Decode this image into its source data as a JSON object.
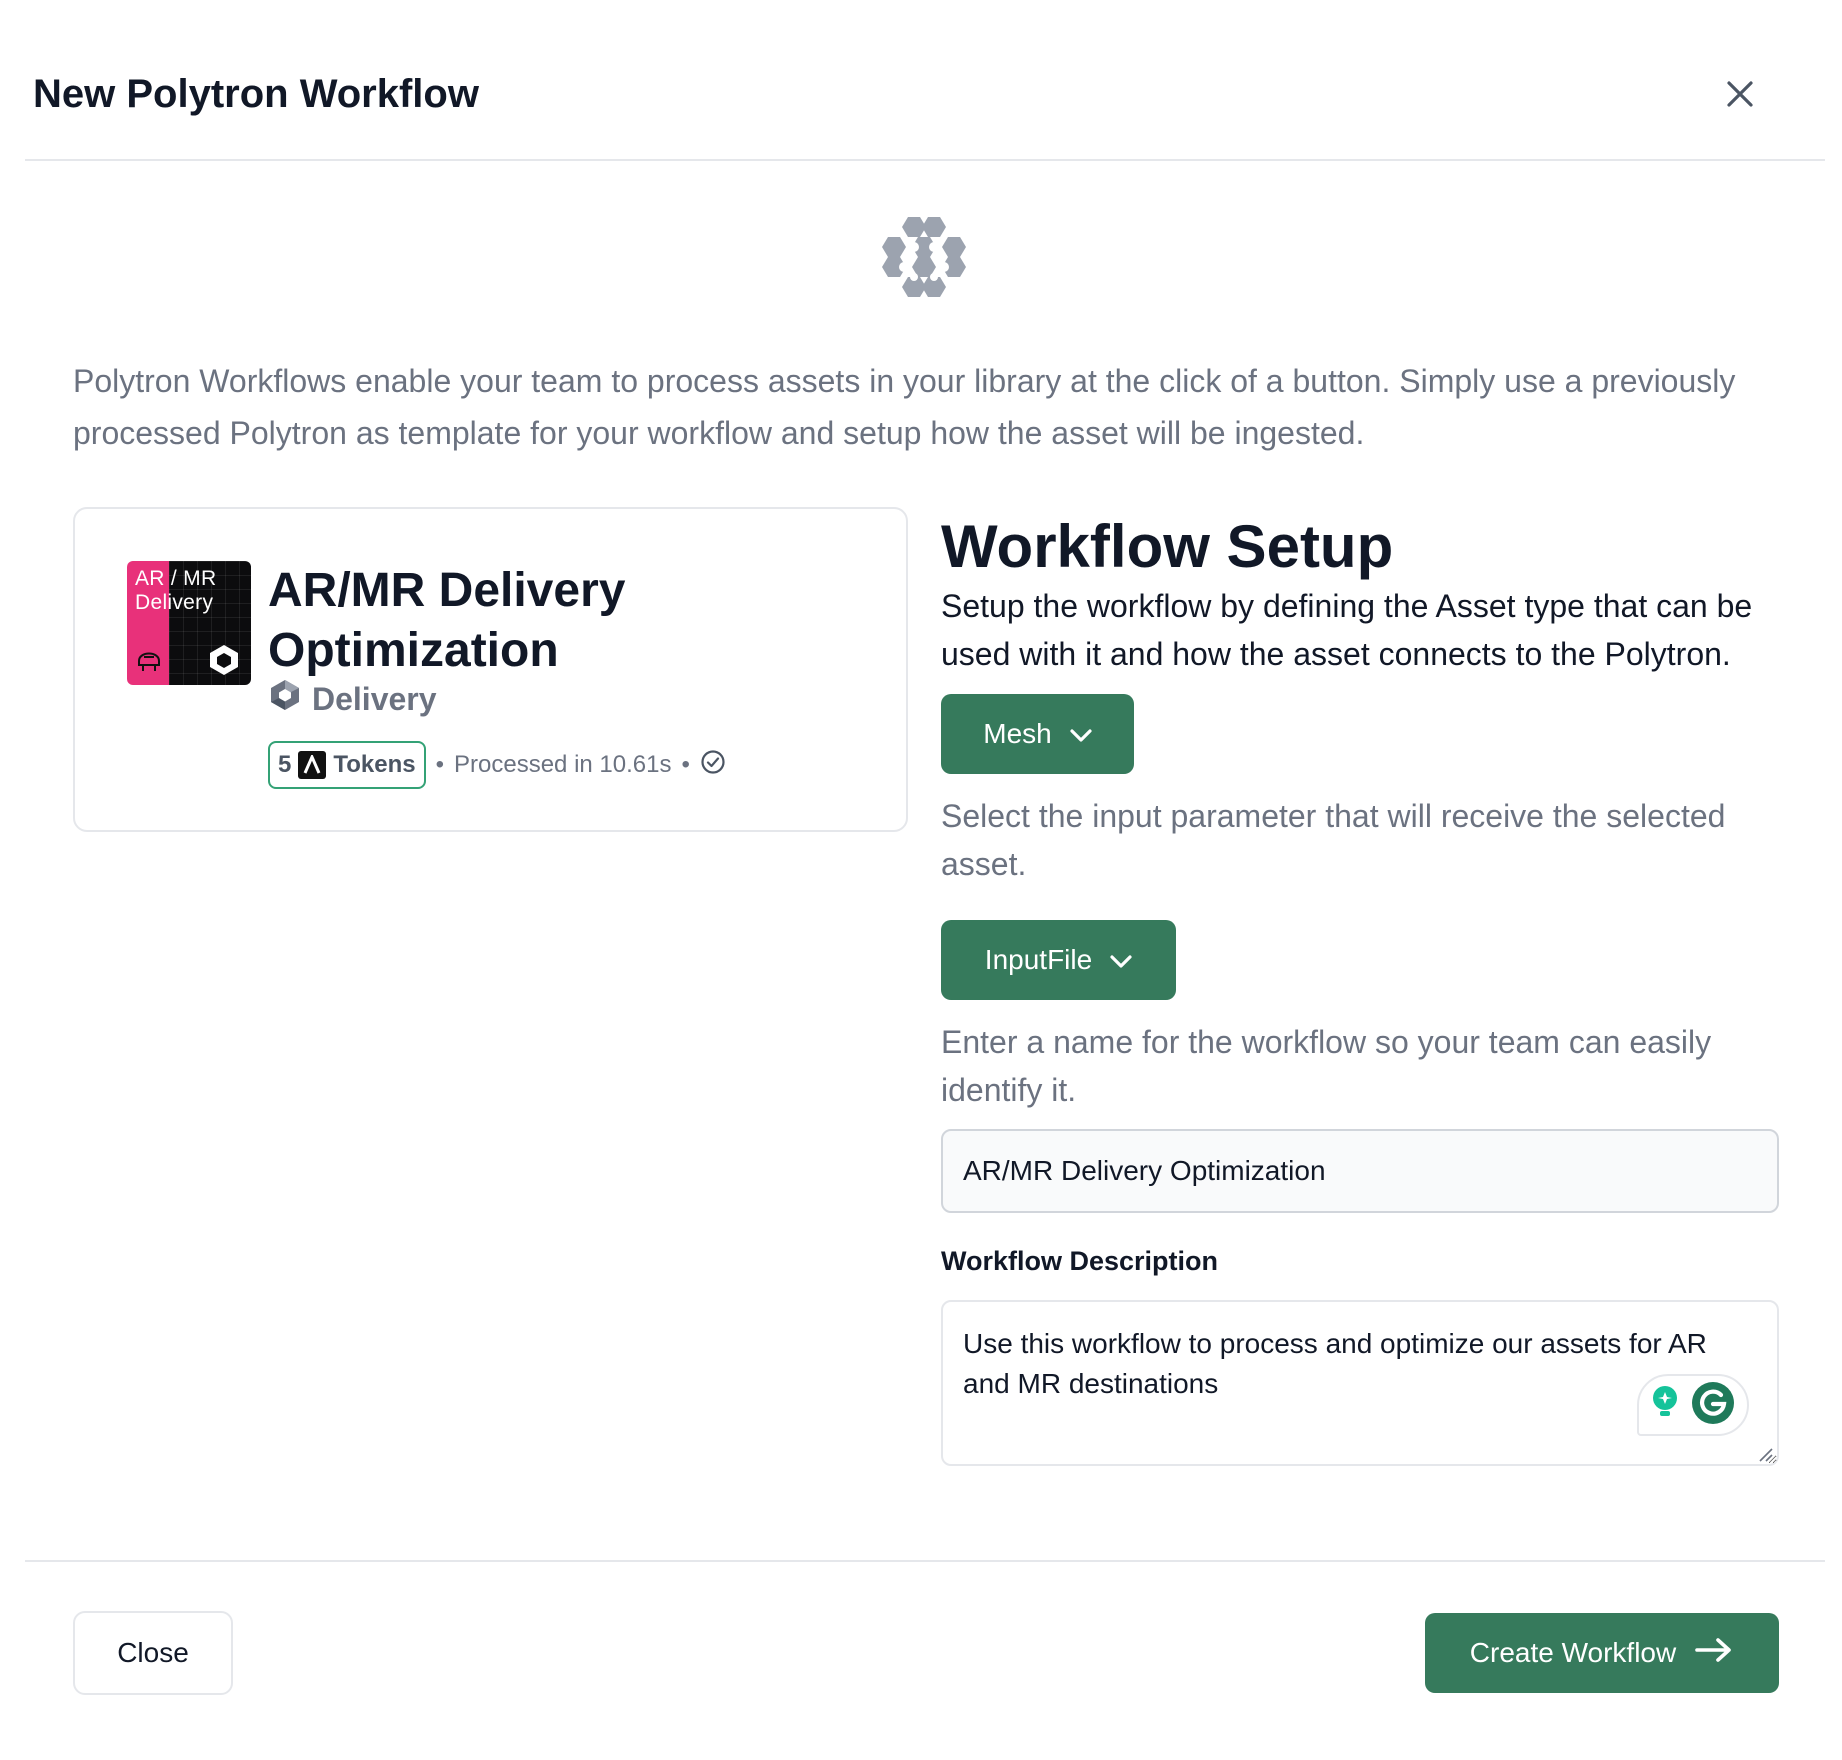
{
  "modal": {
    "title": "New Polytron Workflow",
    "close_icon": "close-icon"
  },
  "hero": {
    "icon": "hexagon-cluster-icon",
    "intro": "Polytron Workflows enable your team to process assets in your library at the click of a button. Simply use a previously processed Polytron as template for your workflow and setup how the asset will be ingested."
  },
  "template_card": {
    "thumbnail_text_line1": "AR / MR",
    "thumbnail_text_line2": "Delivery",
    "title": "AR/MR Delivery Optimization",
    "category": "Delivery",
    "category_icon": "delivery-logo-icon",
    "tokens_count": "5",
    "tokens_label": "Tokens",
    "separator": "•",
    "processed": "Processed in 10.61s",
    "status_icon": "check-circle-icon"
  },
  "setup": {
    "title": "Workflow Setup",
    "description": "Setup the workflow by defining the Asset type that can be used with it and how the asset connects to the Polytron.",
    "asset_type": "Mesh",
    "input_helper": "Select the input parameter that will receive the selected asset.",
    "input_parameter": "InputFile",
    "name_helper": "Enter a name for the workflow so your team can easily identify it.",
    "name_value": "AR/MR Delivery Optimization",
    "description_label": "Workflow Description",
    "description_value": "Use this workflow to process and optimize our assets for AR and MR destinations"
  },
  "footer": {
    "close_label": "Close",
    "create_label": "Create Workflow"
  },
  "colors": {
    "primary": "#367a5c",
    "token_border": "#34a276",
    "thumb_accent": "#e8317a",
    "muted_text": "#6b7280",
    "icon_gray": "#9ca3af"
  }
}
